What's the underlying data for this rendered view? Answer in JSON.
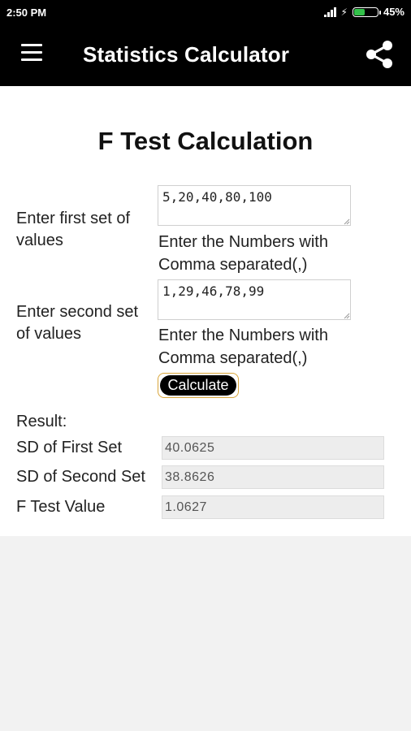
{
  "status_bar": {
    "time": "2:50 PM",
    "battery_percent": "45%",
    "battery_level": 0.45,
    "icons": [
      "signal-icon",
      "charging-bolt-icon",
      "battery-icon"
    ]
  },
  "app_bar": {
    "title": "Statistics Calculator",
    "menu_icon": "hamburger-menu-icon",
    "share_icon": "share-icon"
  },
  "page": {
    "title": "F Test Calculation",
    "first_set_label": "Enter first set of values",
    "first_set_value": "5,20,40,80,100",
    "first_set_hint": "Enter the Numbers with Comma separated(,)",
    "second_set_label": "Enter second set of values",
    "second_set_value": "1,29,46,78,99",
    "second_set_hint": "Enter the Numbers with Comma separated(,)",
    "calculate_label": "Calculate"
  },
  "result": {
    "heading": "Result:",
    "rows": [
      {
        "label": "SD of First Set",
        "value": "40.0625"
      },
      {
        "label": "SD of Second Set",
        "value": "38.8626"
      },
      {
        "label": "F Test Value",
        "value": "1.0627"
      }
    ]
  },
  "colors": {
    "app_bar": "#000000",
    "button_border": "#d9a53a",
    "battery_fill": "#33c14a",
    "readonly_field": "#ededed"
  }
}
